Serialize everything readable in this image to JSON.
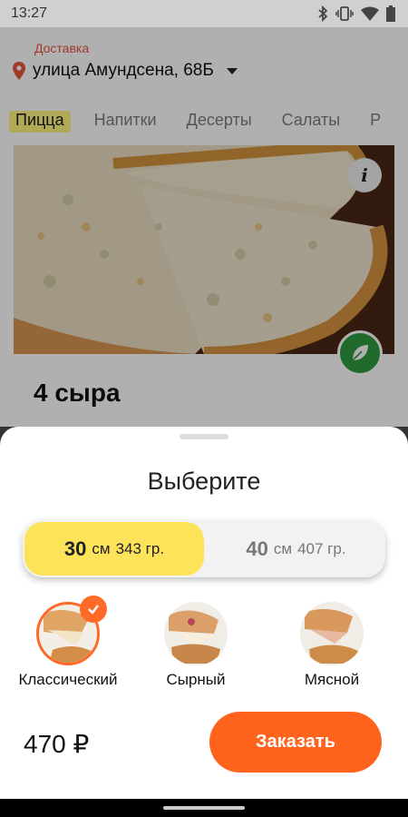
{
  "status_bar": {
    "time": "13:27",
    "icons": [
      "bluetooth-icon",
      "vibrate-icon",
      "wifi-icon",
      "battery-icon"
    ]
  },
  "header": {
    "delivery_label": "Доставка",
    "address": "улица Амундсена, 68Б",
    "icons": [
      "location-pin-icon",
      "chevron-down-icon"
    ]
  },
  "tabs": [
    {
      "label": "Пицца",
      "active": true
    },
    {
      "label": "Напитки",
      "active": false
    },
    {
      "label": "Десерты",
      "active": false
    },
    {
      "label": "Салаты",
      "active": false
    },
    {
      "label": "Р",
      "active": false
    }
  ],
  "product": {
    "name": "4 сыра",
    "info_icon_glyph": "i"
  },
  "sheet": {
    "title": "Выберите",
    "sizes": [
      {
        "number": "30",
        "unit": "см",
        "weight": "343 гр.",
        "selected": true
      },
      {
        "number": "40",
        "unit": "см",
        "weight": "407 гр.",
        "selected": false
      }
    ],
    "crusts": [
      {
        "label": "Классический",
        "selected": true
      },
      {
        "label": "Сырный",
        "selected": false
      },
      {
        "label": "Мясной",
        "selected": false
      }
    ],
    "price": "470 ₽",
    "order_label": "Заказать"
  },
  "colors": {
    "accent": "#ff631e",
    "size_selected": "#fde35a",
    "delivery_label": "#e8563a",
    "veg_badge": "#2f9a3f"
  }
}
